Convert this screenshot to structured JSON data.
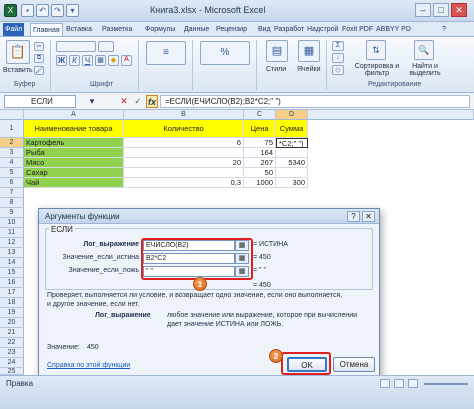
{
  "window": {
    "title": "Книга3.xlsx - Microsoft Excel",
    "controls": [
      "–",
      "□",
      "✕"
    ]
  },
  "ribbon": {
    "tabs": [
      "Файл",
      "Главная",
      "Вставка",
      "Разметка",
      "Формулы",
      "Данные",
      "Рецензир",
      "Вид",
      "Разработ",
      "Надстрой",
      "Foxit PDF",
      "ABBYY PD"
    ],
    "groups": {
      "clipboard": "Буфер",
      "font": "Шрифт",
      "editing": "Редактирование"
    },
    "buttons": {
      "paste": "Вставить",
      "styles": "Стили",
      "cells": "Ячейки",
      "sort": "Сортировка и фильтр",
      "find": "Найти и выделить"
    }
  },
  "formula_bar": {
    "name_box": "ЕСЛИ",
    "fx": "fx",
    "cancel": "✕",
    "enter": "✓",
    "formula": "=ЕСЛИ(ЕЧИСЛО(B2);B2*C2;\" \")"
  },
  "sheet": {
    "columns": [
      "A",
      "B",
      "C",
      "D"
    ],
    "header_row": [
      "Наименование товара",
      "Количество",
      "Цена",
      "Сумма"
    ],
    "rows": [
      {
        "num": "1"
      },
      {
        "num": "2",
        "a": "Картофель",
        "b": "6",
        "c": "75",
        "d": "*C2;\" \")"
      },
      {
        "num": "3",
        "a": "Рыба",
        "b": "",
        "c": "164",
        "d": ""
      },
      {
        "num": "4",
        "a": "Мясо",
        "b": "20",
        "c": "267",
        "d": "5340"
      },
      {
        "num": "5",
        "a": "Сахар",
        "b": "",
        "c": "50",
        "d": ""
      },
      {
        "num": "6",
        "a": "Чай",
        "b": "0,3",
        "c": "1000",
        "d": "300"
      },
      {
        "num": "7"
      },
      {
        "num": "8"
      },
      {
        "num": "9"
      },
      {
        "num": "10"
      },
      {
        "num": "11"
      },
      {
        "num": "12"
      },
      {
        "num": "13"
      },
      {
        "num": "14"
      },
      {
        "num": "15"
      },
      {
        "num": "16"
      },
      {
        "num": "17"
      },
      {
        "num": "18"
      },
      {
        "num": "19"
      },
      {
        "num": "20"
      },
      {
        "num": "21"
      },
      {
        "num": "22"
      },
      {
        "num": "23"
      },
      {
        "num": "24"
      },
      {
        "num": "25"
      }
    ]
  },
  "dialog": {
    "title": "Аргументы функции",
    "function_name": "ЕСЛИ",
    "args": [
      {
        "label": "Лог_выражение",
        "value": "ЕЧИСЛО(B2)",
        "result": "= ИСТИНА"
      },
      {
        "label": "Значение_если_истина",
        "value": "B2*C2",
        "result": "= 450"
      },
      {
        "label": "Значение_если_ложь",
        "value": "\" \"",
        "result": "= \" \""
      }
    ],
    "overall_result": "= 450",
    "description": "Проверяет, выполняется ли условие, и возвращает одно значение, если оно выполняется, и другое значение, если нет.",
    "arg_desc_label": "Лог_выражение",
    "arg_desc_text": "любое значение или выражение, которое при вычислении дает значение ИСТИНА или ЛОЖЬ.",
    "value_label": "Значение:",
    "value": "450",
    "help_link": "Справка по этой функции",
    "ok": "OK",
    "cancel": "Отмена",
    "callouts": [
      "1",
      "2"
    ]
  },
  "status": {
    "ready": "Правка"
  }
}
